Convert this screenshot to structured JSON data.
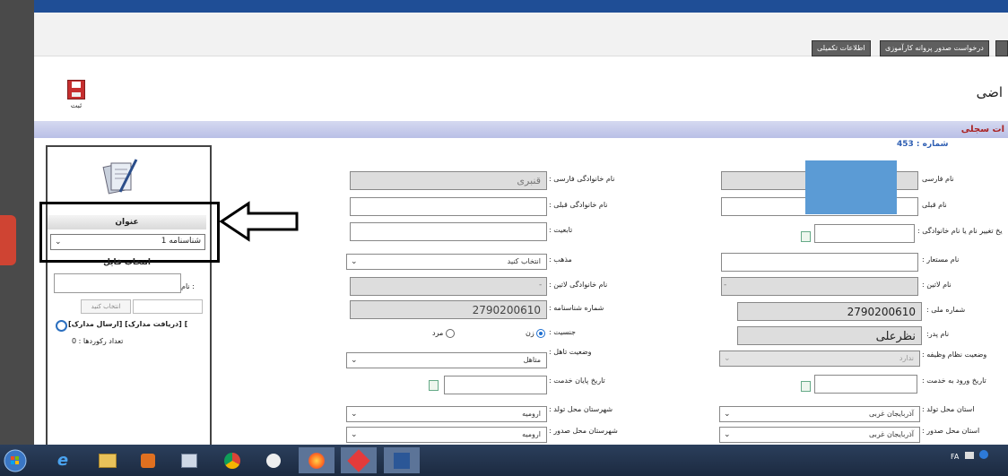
{
  "tabs": [
    {
      "label": "اطلاعات تکمیلی"
    },
    {
      "label": "درخواست صدور پروانه کارآموزی"
    }
  ],
  "toolbar": {
    "save_label": "ثبت"
  },
  "page": {
    "title": "اضی",
    "section_title": "ات سجلی",
    "record_number": "شماره : 453"
  },
  "sidebar": {
    "onvan_label": "عنوان",
    "onvan_value": "شناسنامه 1",
    "select_file_heading": "انتخاب فایل",
    "name_label": "نام :",
    "pick_button": "انتخاب کنید",
    "docs_links": "[ارسال مدارک] [دریافت مدارک] [",
    "record_count": "تعداد رکوردها : 0"
  },
  "form": {
    "persian_last_name": {
      "label": "نام خانوادگی فارسی :",
      "value": "قنبری"
    },
    "previous_last_name": {
      "label": "نام خانوادگی قبلی :",
      "value": ""
    },
    "nationality": {
      "label": "تابعیت :",
      "value": ""
    },
    "religion": {
      "label": "مذهب :",
      "value": "انتخاب کنید"
    },
    "latin_last_name": {
      "label": "نام خانوادگی لاتین :",
      "value": "-"
    },
    "id_number": {
      "label": "شماره شناسنامه :",
      "value": "2790200610"
    },
    "gender": {
      "label": "جنسیت :",
      "female": "زن",
      "male": "مرد"
    },
    "marital_status": {
      "label": "وضعیت تاهل :",
      "value": "متاهل"
    },
    "service_end_date": {
      "label": "تاریخ پایان خدمت :",
      "value": ""
    },
    "birth_city": {
      "label": "شهرستان محل تولد :",
      "value": "ارومیه"
    },
    "issue_city": {
      "label": "شهرستان محل صدور :",
      "value": "ارومیه"
    },
    "persian_first_name": {
      "label": "نام فارسی",
      "value": ""
    },
    "previous_first_name": {
      "label": "نام قبلی",
      "value": ""
    },
    "name_change_date": {
      "label": "یخ تغییر نام یا نام خانوادگی :",
      "value": ""
    },
    "alias": {
      "label": "نام مستعار :",
      "value": ""
    },
    "latin_first_name": {
      "label": "نام لاتین :",
      "value": "-"
    },
    "national_code": {
      "label": "شماره ملی :",
      "value": "2790200610"
    },
    "father_name": {
      "label": "نام پدر:",
      "value": "نظرعلی"
    },
    "military_status": {
      "label": "وضعیت نظام وظیفه :",
      "value": "ندارد"
    },
    "service_start_date": {
      "label": "تاریخ ورود به خدمت :",
      "value": ""
    },
    "birth_province": {
      "label": "استان محل تولد :",
      "value": "آذربایجان غربی"
    },
    "issue_province": {
      "label": "استان محل صدور :",
      "value": "آذربایجان غربی"
    }
  },
  "taskbar": {
    "lang": "FA"
  },
  "colors": {
    "topbar": "#1f4e96",
    "section_bar": "#c3c8ea",
    "section_title": "#a22222",
    "record_number": "#2f5fb3",
    "redaction": "#5b9bd5"
  }
}
